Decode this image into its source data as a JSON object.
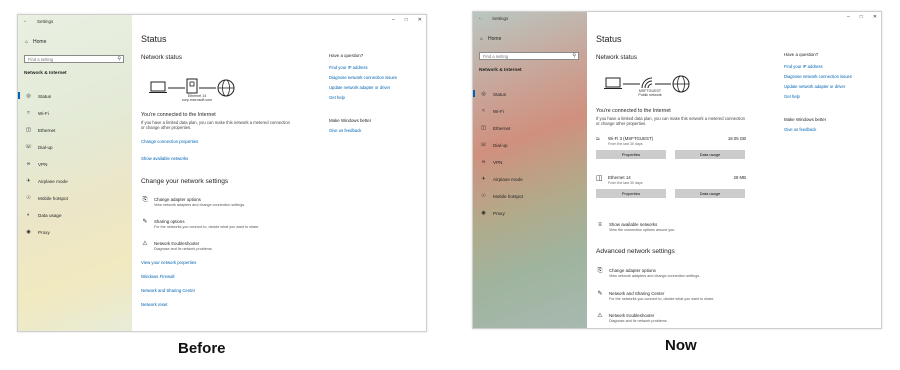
{
  "captions": {
    "before": "Before",
    "now": "Now"
  },
  "colors": {
    "accent": "#0063b1",
    "button": "#cccccc"
  },
  "common": {
    "window_title": "Settings",
    "home": "Home",
    "search_placeholder": "Find a setting",
    "section": "Network & Internet",
    "sidebar_items": [
      {
        "label": "Status",
        "icon": "status-icon"
      },
      {
        "label": "Wi-Fi",
        "icon": "wifi-icon"
      },
      {
        "label": "Ethernet",
        "icon": "ethernet-icon"
      },
      {
        "label": "Dial-up",
        "icon": "dialup-icon"
      },
      {
        "label": "VPN",
        "icon": "vpn-icon"
      },
      {
        "label": "Airplane mode",
        "icon": "airplane-icon"
      },
      {
        "label": "Mobile hotspot",
        "icon": "hotspot-icon"
      },
      {
        "label": "Data usage",
        "icon": "data-usage-icon"
      },
      {
        "label": "Proxy",
        "icon": "proxy-icon"
      }
    ],
    "page_title": "Status",
    "network_status": "Network status",
    "connected": "You're connected to the Internet",
    "connected_desc": "If you have a limited data plan, you can make this network a metered connection or change other properties.",
    "question": "Have a question?",
    "right_links": [
      "Find your IP address",
      "Diagnose network connection issues",
      "Update network adapter or driver",
      "Get help"
    ],
    "make_better": "Make Windows better",
    "feedback": "Give us feedback"
  },
  "before": {
    "diagram_caption_1": "Ethernet 14",
    "diagram_caption_2": "corp.microsoft.com",
    "change_props": "Change connection properties",
    "show_networks": "Show available networks",
    "change_settings": "Change your network settings",
    "options": [
      {
        "title": "Change adapter options",
        "desc": "View network adapters and change connection settings.",
        "icon": "adapter-icon"
      },
      {
        "title": "Sharing options",
        "desc": "For the networks you connect to, decide what you want to share.",
        "icon": "sharing-icon"
      },
      {
        "title": "Network troubleshooter",
        "desc": "Diagnose and fix network problems.",
        "icon": "warning-icon"
      }
    ],
    "bottom_links": [
      "View your network properties",
      "Windows Firewall",
      "Network and Sharing Center",
      "Network reset"
    ]
  },
  "now": {
    "diagram_caption_1": "MSFTGUEST",
    "diagram_caption_2": "Public network",
    "adapters": [
      {
        "name": "Wi-Fi 3 (MSFTGUEST)",
        "sub": "From the last 30 days",
        "usage": "18.05 GB",
        "icon": "wifi-icon"
      },
      {
        "name": "Ethernet 14",
        "sub": "From the last 30 days",
        "usage": "28 MB",
        "icon": "ethernet-icon"
      }
    ],
    "properties_label": "Properties",
    "data_usage_label": "Data usage",
    "show_networks": {
      "title": "Show available networks",
      "desc": "View the connection options around you."
    },
    "advanced": "Advanced network settings",
    "options": [
      {
        "title": "Change adapter options",
        "desc": "View network adapters and change connection settings.",
        "icon": "adapter-icon"
      },
      {
        "title": "Network and Sharing Center",
        "desc": "For the networks you connect to, decide what you want to share.",
        "icon": "sharing-icon"
      },
      {
        "title": "Network troubleshooter",
        "desc": "Diagnose and fix network problems.",
        "icon": "warning-icon"
      }
    ]
  }
}
